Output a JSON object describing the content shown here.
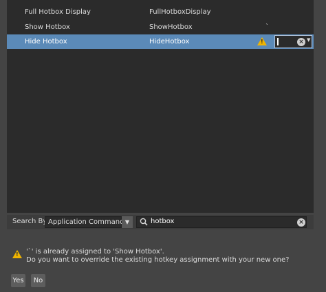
{
  "hotkey_list": {
    "rows": [
      {
        "command": "Full Hotbox Display",
        "name": "FullHotboxDisplay",
        "hotkey": ""
      },
      {
        "command": "Show Hotbox",
        "name": "ShowHotbox",
        "hotkey": "`"
      },
      {
        "command": "Hide Hotbox",
        "name": "HideHotbox",
        "hotkey": ""
      }
    ],
    "selected_row": 2,
    "editor": {
      "value": "",
      "icon": "clear-icon"
    },
    "warning_icon": "warning-icon"
  },
  "search": {
    "label": "Search By:",
    "search_by": "Application Command",
    "query": "hotbox",
    "icons": [
      "search-icon",
      "clear-icon"
    ]
  },
  "message": {
    "line1": "'`' is already assigned to 'Show Hotbox'.",
    "line2": "Do you want to override the existing hotkey assignment with your new one?",
    "icon": "warning-icon"
  },
  "buttons": {
    "yes": "Yes",
    "no": "No"
  },
  "colors": {
    "background": "#444444",
    "panel": "#2b2b2b",
    "selection": "#5b8ab8",
    "warning": "#f0b400"
  }
}
